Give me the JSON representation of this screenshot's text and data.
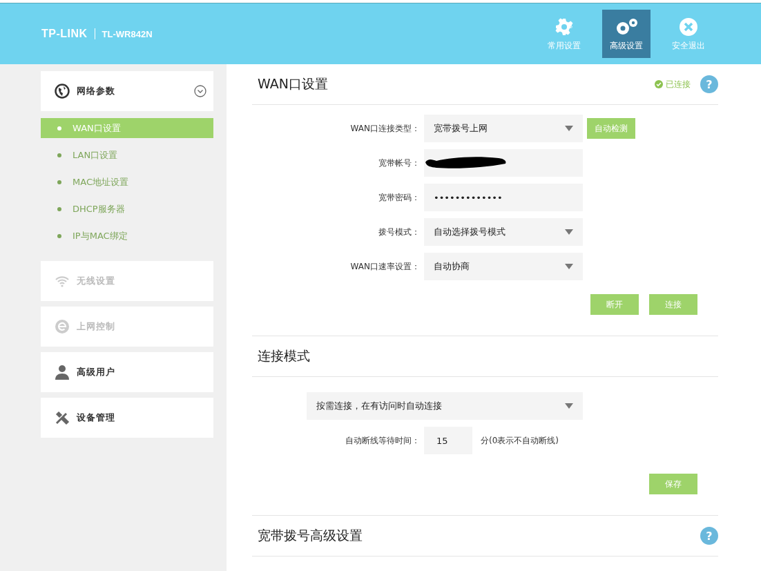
{
  "header": {
    "brand": "TP-LINK",
    "model": "TL-WR842N",
    "nav": [
      {
        "kind": "gear",
        "label": "常用设置",
        "selected": false
      },
      {
        "kind": "gears",
        "label": "高级设置",
        "selected": true
      },
      {
        "kind": "exit",
        "label": "安全退出",
        "selected": false
      }
    ]
  },
  "sidebar": {
    "groups": [
      {
        "kind": "globe",
        "label": "网络参数",
        "expanded": true,
        "children": [
          {
            "label": "WAN口设置",
            "selected": true
          },
          {
            "label": "LAN口设置",
            "selected": false
          },
          {
            "label": "MAC地址设置",
            "selected": false
          },
          {
            "label": "DHCP服务器",
            "selected": false
          },
          {
            "label": "IP与MAC绑定",
            "selected": false
          }
        ]
      },
      {
        "kind": "wifi",
        "label": "无线设置",
        "expanded": false
      },
      {
        "kind": "e",
        "label": "上网控制",
        "expanded": false
      },
      {
        "kind": "user",
        "label": "高级用户",
        "expanded": false
      },
      {
        "kind": "tools",
        "label": "设备管理",
        "expanded": false
      }
    ]
  },
  "wan": {
    "title": "WAN口设置",
    "status": "已连接",
    "help": "?",
    "fields": [
      {
        "kind": "select",
        "label": "WAN口连接类型：",
        "value": "宽带拨号上网",
        "button": "自动检测"
      },
      {
        "kind": "redacted",
        "label": "宽带帐号："
      },
      {
        "kind": "text",
        "label": "宽带密码：",
        "value": "•••••••••••••"
      },
      {
        "kind": "select",
        "label": "拨号模式：",
        "value": "自动选择拨号模式"
      },
      {
        "kind": "select",
        "label": "WAN口速率设置：",
        "value": "自动协商"
      }
    ],
    "buttons": [
      "断开",
      "连接"
    ]
  },
  "mode": {
    "title": "连接模式",
    "select": "按需连接，在有访问时自动连接",
    "wait_label": "自动断线等待时间：",
    "wait_value": "15",
    "wait_unit": "分(0表示不自动断线)",
    "button": "保存"
  },
  "advanced": {
    "title": "宽带拨号高级设置",
    "help": "?"
  }
}
